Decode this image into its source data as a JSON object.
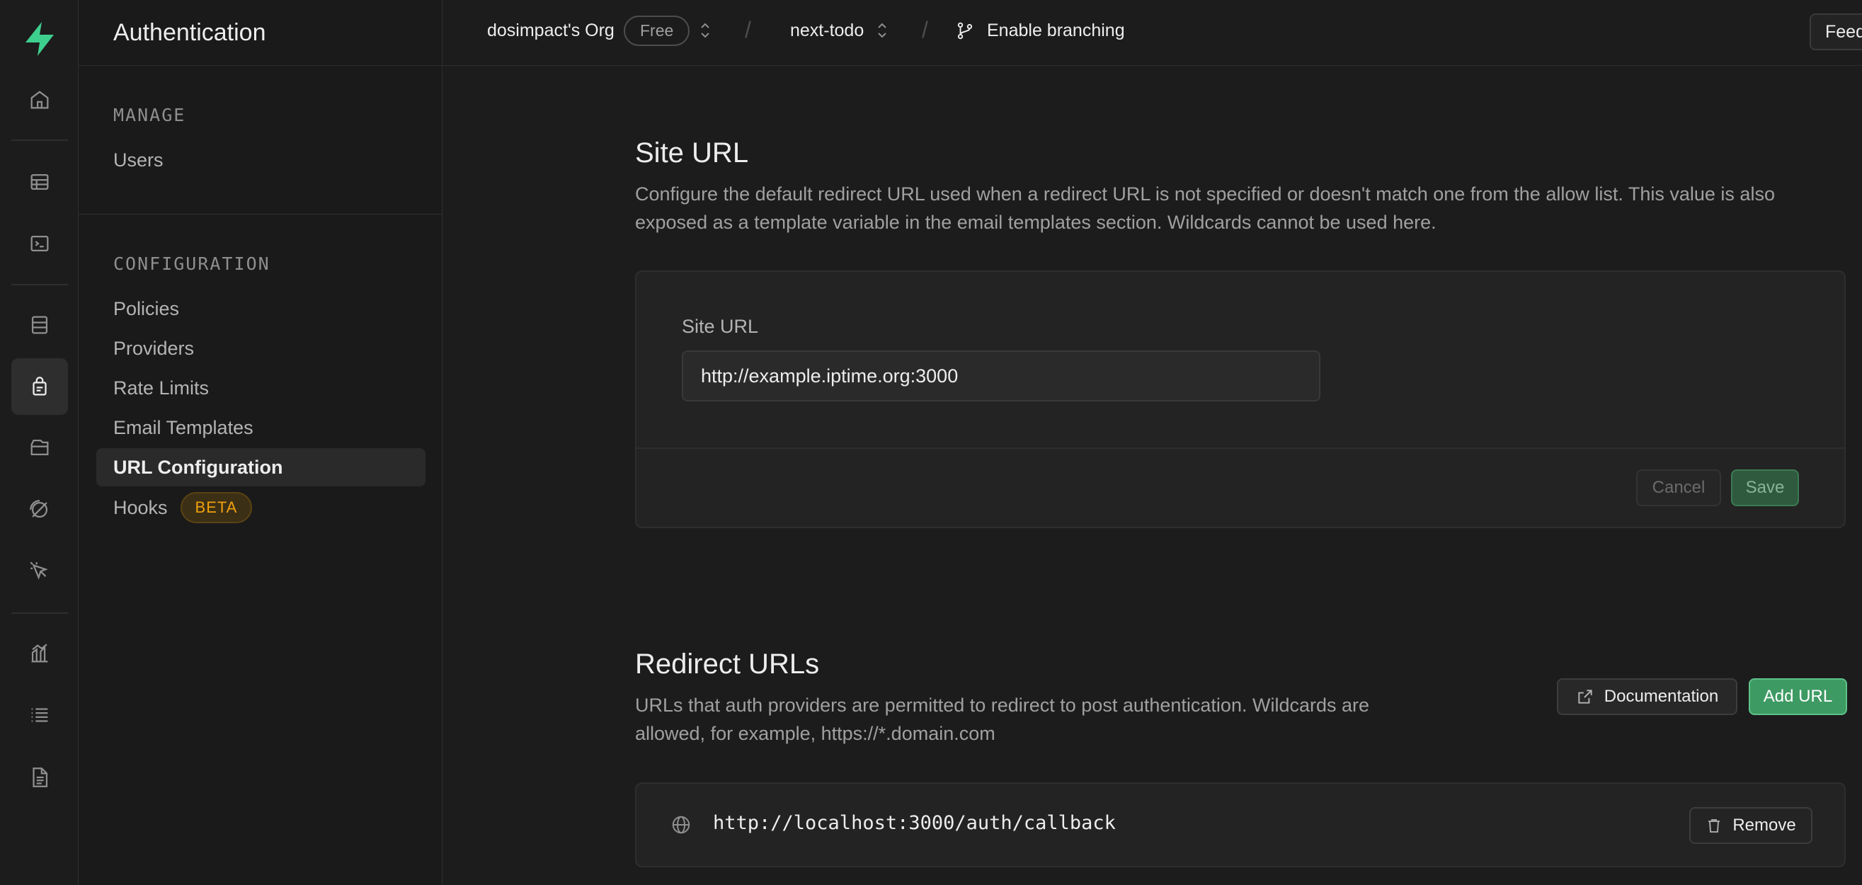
{
  "rail": {
    "icons": [
      "logo-icon",
      "home-icon",
      "table-editor-icon",
      "sql-editor-icon",
      "database-icon",
      "authentication-icon",
      "storage-icon",
      "realtime-icon",
      "edge-functions-icon",
      "reports-icon",
      "logs-icon",
      "docs-icon"
    ],
    "active": "authentication-icon",
    "brand_color": "#3ecf8e"
  },
  "sidebar": {
    "title": "Authentication",
    "manage_label": "MANAGE",
    "manage_items": [
      {
        "label": "Users"
      }
    ],
    "config_label": "CONFIGURATION",
    "config_items": [
      {
        "label": "Policies"
      },
      {
        "label": "Providers"
      },
      {
        "label": "Rate Limits"
      },
      {
        "label": "Email Templates"
      },
      {
        "label": "URL Configuration",
        "active": true
      },
      {
        "label": "Hooks",
        "badge": "BETA"
      }
    ]
  },
  "topbar": {
    "org": "dosimpact's Org",
    "plan": "Free",
    "separator": "/",
    "project": "next-todo",
    "branching": "Enable branching",
    "feedback": "Feed"
  },
  "site_url": {
    "title": "Site URL",
    "description_line1": "Configure the default redirect URL used when a redirect URL is not specified or doesn't match one from the allow list. This value is also",
    "description_line2": "exposed as a template variable in the email templates section. Wildcards cannot be used here.",
    "field_label": "Site URL",
    "value": "http://example.iptime.org:3000",
    "cancel": "Cancel",
    "save": "Save"
  },
  "redirect_urls": {
    "title": "Redirect URLs",
    "description_line1": "URLs that auth providers are permitted to redirect to post authentication. Wildcards are",
    "description_line2": "allowed, for example, https://*.domain.com",
    "documentation": "Documentation",
    "add_url": "Add URL",
    "urls": [
      {
        "url": "http://localhost:3000/auth/callback",
        "remove": "Remove"
      }
    ]
  }
}
